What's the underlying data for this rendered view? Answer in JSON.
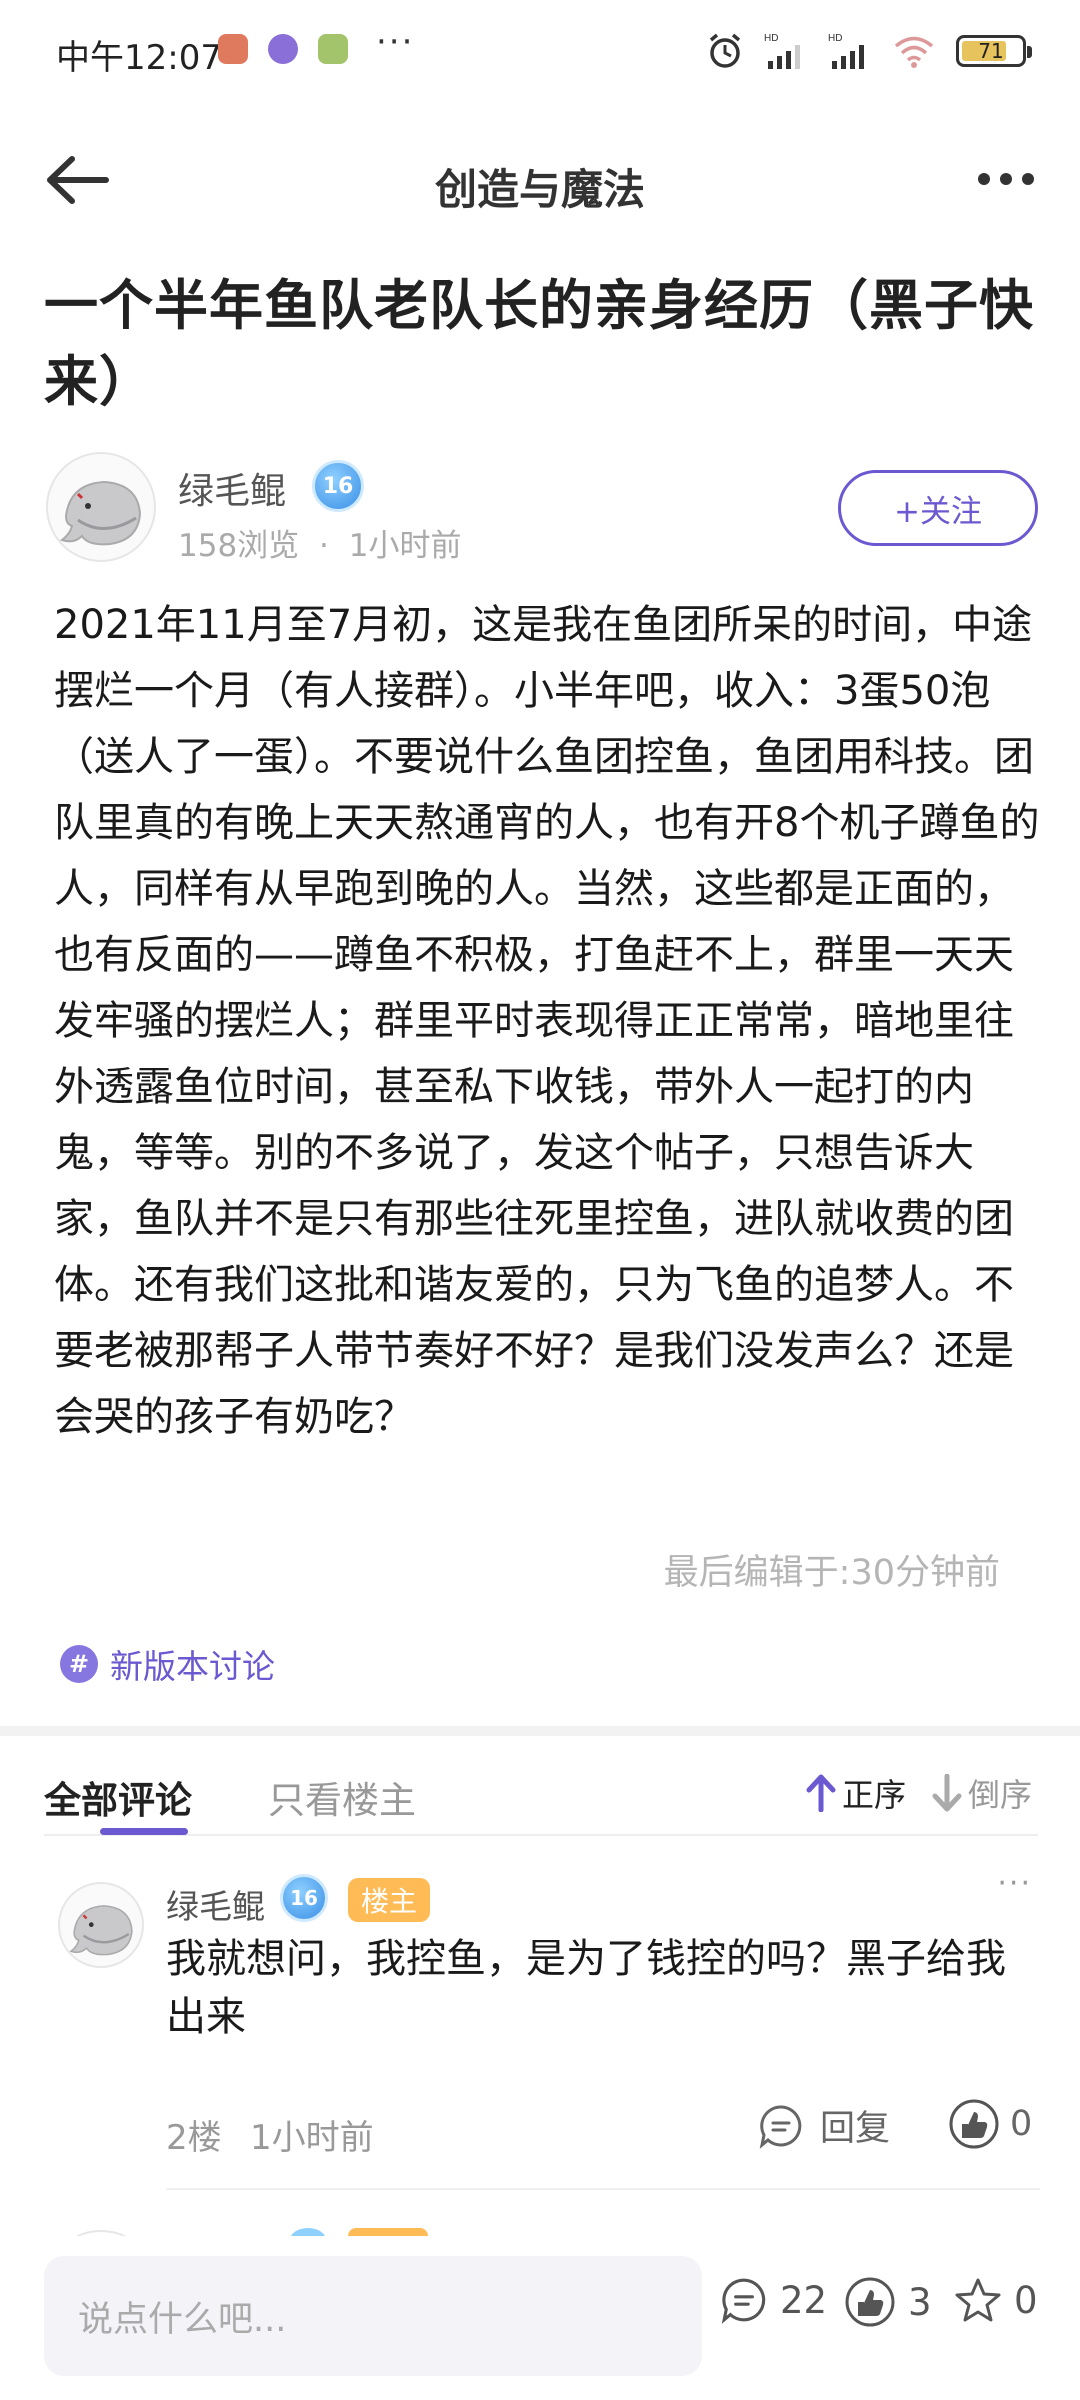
{
  "status_bar": {
    "time": "中午12:07",
    "more": "···",
    "network_label_1": "HD",
    "network_label_2": "HD",
    "battery": "71"
  },
  "header": {
    "title": "创造与魔法"
  },
  "post": {
    "title": "一个半年鱼队老队长的亲身经历（黑子快来）",
    "author": {
      "name": "绿毛鲲",
      "level": "16",
      "views": "158浏览",
      "separator": "·",
      "time": "1小时前"
    },
    "follow_label": "+关注",
    "body": "2021年11月至7月初，这是我在鱼团所呆的时间，中途摆烂一个月（有人接群）。小半年吧，收入：3蛋50泡（送人了一蛋）。不要说什么鱼团控鱼，鱼团用科技。团队里真的有晚上天天熬通宵的人，也有开8个机子蹲鱼的人，同样有从早跑到晚的人。当然，这些都是正面的，也有反面的——蹲鱼不积极，打鱼赶不上，群里一天天发牢骚的摆烂人；群里平时表现得正正常常，暗地里往外透露鱼位时间，甚至私下收钱，带外人一起打的内鬼，等等。别的不多说了，发这个帖子，只想告诉大家，鱼队并不是只有那些往死里控鱼，进队就收费的团体。还有我们这批和谐友爱的，只为飞鱼的追梦人。不要老被那帮子人带节奏好不好？是我们没发声么？还是会哭的孩子有奶吃？",
    "edited": "最后编辑于:30分钟前",
    "topic": "新版本讨论",
    "topic_symbol": "#"
  },
  "comments_section": {
    "tab_all": "全部评论",
    "tab_owner": "只看楼主",
    "sort_asc": "正序",
    "sort_desc": "倒序",
    "comments": [
      {
        "name": "绿毛鲲",
        "level": "16",
        "badge": "楼主",
        "text": "我就想问，我控鱼，是为了钱控的吗？黑子给我出来",
        "floor": "2楼",
        "time": "1小时前",
        "reply_label": "回复",
        "likes": "0",
        "more": "···"
      }
    ]
  },
  "bottom_bar": {
    "input_placeholder": "说点什么吧...",
    "comments_count": "22",
    "likes_count": "3",
    "favorites_count": "0"
  },
  "colors": {
    "accent": "#6a59d0",
    "owner_badge": "#ffbb55",
    "level_badge": "#3a8fe6"
  }
}
